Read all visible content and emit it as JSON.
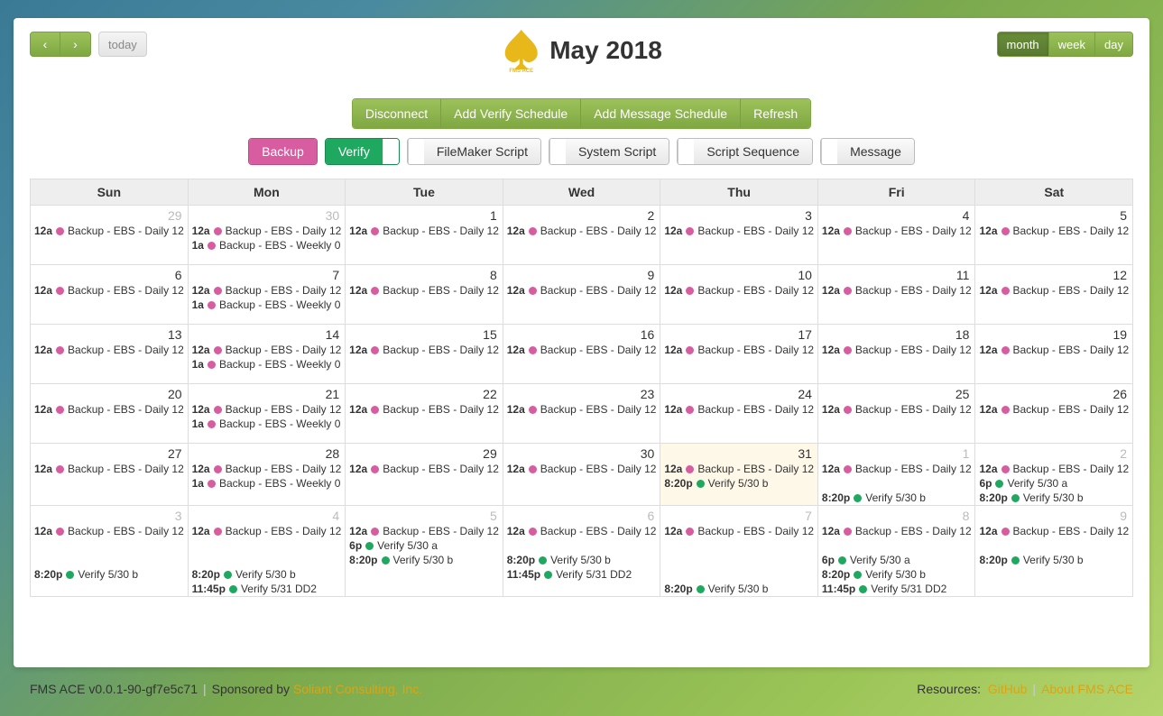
{
  "header": {
    "title": "May 2018",
    "logo_caption": "FMS ACE",
    "today_label": "today",
    "views": {
      "month": "month",
      "week": "week",
      "day": "day"
    },
    "active_view": "month"
  },
  "actions": {
    "disconnect": "Disconnect",
    "add_verify": "Add Verify Schedule",
    "add_message": "Add Message Schedule",
    "refresh": "Refresh"
  },
  "filters": {
    "backup": "Backup",
    "verify": "Verify",
    "fm_script": "FileMaker Script",
    "sys_script": "System Script",
    "script_seq": "Script Sequence",
    "message": "Message"
  },
  "dayheads": [
    "Sun",
    "Mon",
    "Tue",
    "Wed",
    "Thu",
    "Fri",
    "Sat"
  ],
  "weeks": [
    [
      {
        "num": "29",
        "other": true,
        "events": [
          [
            "12a",
            "pink",
            "Backup - EBS - Daily 12"
          ]
        ]
      },
      {
        "num": "30",
        "other": true,
        "events": [
          [
            "12a",
            "pink",
            "Backup - EBS - Daily 12"
          ],
          [
            "1a",
            "pink",
            "Backup - EBS - Weekly 0"
          ]
        ]
      },
      {
        "num": "1",
        "events": [
          [
            "12a",
            "pink",
            "Backup - EBS - Daily 12"
          ]
        ]
      },
      {
        "num": "2",
        "events": [
          [
            "12a",
            "pink",
            "Backup - EBS - Daily 12"
          ]
        ]
      },
      {
        "num": "3",
        "events": [
          [
            "12a",
            "pink",
            "Backup - EBS - Daily 12"
          ]
        ]
      },
      {
        "num": "4",
        "events": [
          [
            "12a",
            "pink",
            "Backup - EBS - Daily 12"
          ]
        ]
      },
      {
        "num": "5",
        "events": [
          [
            "12a",
            "pink",
            "Backup - EBS - Daily 12"
          ]
        ]
      }
    ],
    [
      {
        "num": "6",
        "events": [
          [
            "12a",
            "pink",
            "Backup - EBS - Daily 12"
          ]
        ]
      },
      {
        "num": "7",
        "events": [
          [
            "12a",
            "pink",
            "Backup - EBS - Daily 12"
          ],
          [
            "1a",
            "pink",
            "Backup - EBS - Weekly 0"
          ]
        ]
      },
      {
        "num": "8",
        "events": [
          [
            "12a",
            "pink",
            "Backup - EBS - Daily 12"
          ]
        ]
      },
      {
        "num": "9",
        "events": [
          [
            "12a",
            "pink",
            "Backup - EBS - Daily 12"
          ]
        ]
      },
      {
        "num": "10",
        "events": [
          [
            "12a",
            "pink",
            "Backup - EBS - Daily 12"
          ]
        ]
      },
      {
        "num": "11",
        "events": [
          [
            "12a",
            "pink",
            "Backup - EBS - Daily 12"
          ]
        ]
      },
      {
        "num": "12",
        "events": [
          [
            "12a",
            "pink",
            "Backup - EBS - Daily 12"
          ]
        ]
      }
    ],
    [
      {
        "num": "13",
        "events": [
          [
            "12a",
            "pink",
            "Backup - EBS - Daily 12"
          ]
        ]
      },
      {
        "num": "14",
        "events": [
          [
            "12a",
            "pink",
            "Backup - EBS - Daily 12"
          ],
          [
            "1a",
            "pink",
            "Backup - EBS - Weekly 0"
          ]
        ]
      },
      {
        "num": "15",
        "events": [
          [
            "12a",
            "pink",
            "Backup - EBS - Daily 12"
          ]
        ]
      },
      {
        "num": "16",
        "events": [
          [
            "12a",
            "pink",
            "Backup - EBS - Daily 12"
          ]
        ]
      },
      {
        "num": "17",
        "events": [
          [
            "12a",
            "pink",
            "Backup - EBS - Daily 12"
          ]
        ]
      },
      {
        "num": "18",
        "events": [
          [
            "12a",
            "pink",
            "Backup - EBS - Daily 12"
          ]
        ]
      },
      {
        "num": "19",
        "events": [
          [
            "12a",
            "pink",
            "Backup - EBS - Daily 12"
          ]
        ]
      }
    ],
    [
      {
        "num": "20",
        "events": [
          [
            "12a",
            "pink",
            "Backup - EBS - Daily 12"
          ]
        ]
      },
      {
        "num": "21",
        "events": [
          [
            "12a",
            "pink",
            "Backup - EBS - Daily 12"
          ],
          [
            "1a",
            "pink",
            "Backup - EBS - Weekly 0"
          ]
        ]
      },
      {
        "num": "22",
        "events": [
          [
            "12a",
            "pink",
            "Backup - EBS - Daily 12"
          ]
        ]
      },
      {
        "num": "23",
        "events": [
          [
            "12a",
            "pink",
            "Backup - EBS - Daily 12"
          ]
        ]
      },
      {
        "num": "24",
        "events": [
          [
            "12a",
            "pink",
            "Backup - EBS - Daily 12"
          ]
        ]
      },
      {
        "num": "25",
        "events": [
          [
            "12a",
            "pink",
            "Backup - EBS - Daily 12"
          ]
        ]
      },
      {
        "num": "26",
        "events": [
          [
            "12a",
            "pink",
            "Backup - EBS - Daily 12"
          ]
        ]
      }
    ],
    [
      {
        "num": "27",
        "events": [
          [
            "12a",
            "pink",
            "Backup - EBS - Daily 12"
          ]
        ]
      },
      {
        "num": "28",
        "events": [
          [
            "12a",
            "pink",
            "Backup - EBS - Daily 12"
          ],
          [
            "1a",
            "pink",
            "Backup - EBS - Weekly 0"
          ]
        ]
      },
      {
        "num": "29",
        "events": [
          [
            "12a",
            "pink",
            "Backup - EBS - Daily 12"
          ]
        ]
      },
      {
        "num": "30",
        "events": [
          [
            "12a",
            "pink",
            "Backup - EBS - Daily 12"
          ]
        ]
      },
      {
        "num": "31",
        "today": true,
        "events": [
          [
            "12a",
            "pink",
            "Backup - EBS - Daily 12"
          ],
          [
            "8:20p",
            "green",
            "Verify 5/30 b"
          ]
        ]
      },
      {
        "num": "1",
        "other": true,
        "events": [
          [
            "12a",
            "pink",
            "Backup - EBS - Daily 12"
          ],
          [
            "",
            "",
            ""
          ],
          [
            "8:20p",
            "green",
            "Verify 5/30 b"
          ]
        ]
      },
      {
        "num": "2",
        "other": true,
        "events": [
          [
            "12a",
            "pink",
            "Backup - EBS - Daily 12"
          ],
          [
            "6p",
            "green",
            "Verify 5/30 a"
          ],
          [
            "8:20p",
            "green",
            "Verify 5/30 b"
          ]
        ]
      }
    ],
    [
      {
        "num": "3",
        "other": true,
        "events": [
          [
            "12a",
            "pink",
            "Backup - EBS - Daily 12"
          ],
          [
            "",
            "",
            ""
          ],
          [
            "",
            "",
            ""
          ],
          [
            "8:20p",
            "green",
            "Verify 5/30 b"
          ]
        ]
      },
      {
        "num": "4",
        "other": true,
        "events": [
          [
            "12a",
            "pink",
            "Backup - EBS - Daily 12"
          ],
          [
            "",
            "",
            ""
          ],
          [
            "",
            "",
            ""
          ],
          [
            "8:20p",
            "green",
            "Verify 5/30 b"
          ],
          [
            "11:45p",
            "green",
            "Verify 5/31 DD2"
          ]
        ]
      },
      {
        "num": "5",
        "other": true,
        "events": [
          [
            "12a",
            "pink",
            "Backup - EBS - Daily 12"
          ],
          [
            "6p",
            "green",
            "Verify 5/30 a"
          ],
          [
            "8:20p",
            "green",
            "Verify 5/30 b"
          ]
        ]
      },
      {
        "num": "6",
        "other": true,
        "events": [
          [
            "12a",
            "pink",
            "Backup - EBS - Daily 12"
          ],
          [
            "",
            "",
            ""
          ],
          [
            "8:20p",
            "green",
            "Verify 5/30 b"
          ],
          [
            "11:45p",
            "green",
            "Verify 5/31 DD2"
          ]
        ]
      },
      {
        "num": "7",
        "other": true,
        "events": [
          [
            "12a",
            "pink",
            "Backup - EBS - Daily 12"
          ],
          [
            "",
            "",
            ""
          ],
          [
            "",
            "",
            ""
          ],
          [
            "",
            "",
            ""
          ],
          [
            "8:20p",
            "green",
            "Verify 5/30 b"
          ]
        ]
      },
      {
        "num": "8",
        "other": true,
        "events": [
          [
            "12a",
            "pink",
            "Backup - EBS - Daily 12"
          ],
          [
            "",
            "",
            ""
          ],
          [
            "6p",
            "green",
            "Verify 5/30 a"
          ],
          [
            "8:20p",
            "green",
            "Verify 5/30 b"
          ],
          [
            "11:45p",
            "green",
            "Verify 5/31 DD2"
          ]
        ]
      },
      {
        "num": "9",
        "other": true,
        "events": [
          [
            "12a",
            "pink",
            "Backup - EBS - Daily 12"
          ],
          [
            "",
            "",
            ""
          ],
          [
            "8:20p",
            "green",
            "Verify 5/30 b"
          ]
        ]
      }
    ]
  ],
  "footer": {
    "version": "FMS ACE v0.0.1-90-gf7e5c71",
    "sponsored_label": "Sponsored by",
    "sponsor_link": "Soliant Consulting, Inc.",
    "resources_label": "Resources:",
    "github": "GitHub",
    "about": "About FMS ACE"
  }
}
